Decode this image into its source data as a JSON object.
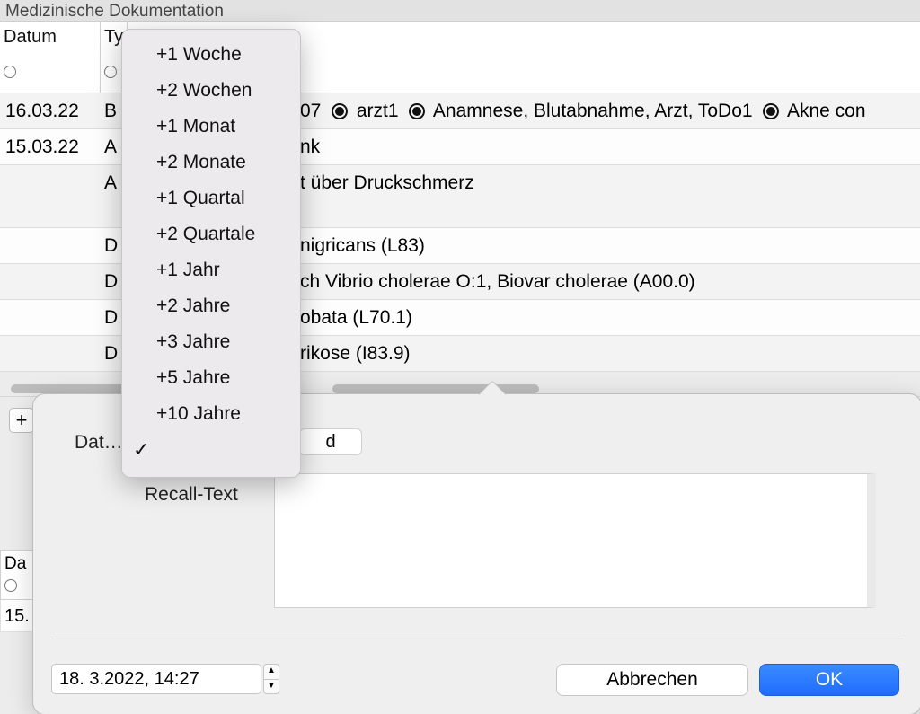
{
  "window": {
    "title": "Medizinische Dokumentation"
  },
  "columns": {
    "date": "Datum",
    "type": "Ty"
  },
  "rows": [
    {
      "date": "16.03.22",
      "type": "B",
      "tail_prefix": "07",
      "bullets": [
        "arzt1",
        "Anamnese, Blutabnahme, Arzt, ToDo1",
        "Akne con"
      ]
    },
    {
      "date": "15.03.22",
      "type": "A",
      "tail": "nk"
    },
    {
      "date": "",
      "type": "A",
      "tail": "t über Druckschmerz",
      "tall": true
    },
    {
      "date": "",
      "type": "D",
      "tail": "nigricans (L83)"
    },
    {
      "date": "",
      "type": "D",
      "tail": "ch Vibrio cholerae O:1, Biovar cholerae (A00.0)"
    },
    {
      "date": "",
      "type": "D",
      "tail": "obata (L70.1)"
    },
    {
      "date": "",
      "type": "D",
      "tail": "rikose (I83.9)"
    }
  ],
  "toolbar": {
    "plus": "+"
  },
  "mini_table": {
    "header": "Da",
    "row": "15."
  },
  "popover": {
    "date_label": "Dat…",
    "chip": "d",
    "recall_label": "Recall-Text",
    "datetime": "18.  3.2022, 14:27",
    "cancel": "Abbrechen",
    "ok": "OK"
  },
  "menu": {
    "items": [
      "+1 Woche",
      "+2 Wochen",
      "+1 Monat",
      "+2 Monate",
      "+1 Quartal",
      "+2 Quartale",
      "+1 Jahr",
      "+2 Jahre",
      "+3 Jahre",
      "+5 Jahre",
      "+10 Jahre"
    ],
    "checked_index": 11
  }
}
